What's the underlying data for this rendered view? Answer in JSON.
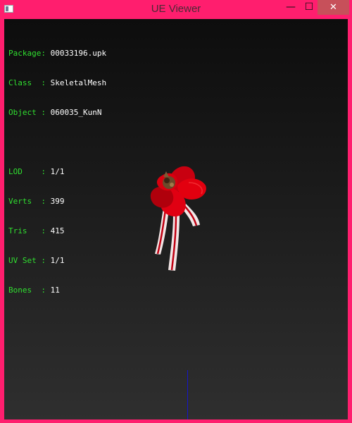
{
  "window": {
    "title": "UE Viewer"
  },
  "controls": {
    "minimize": "—",
    "maximize": "☐",
    "close": "✕"
  },
  "info": {
    "package_key": "Package:",
    "package_val": "00033196.upk",
    "class_key": "Class  :",
    "class_val": "SkeletalMesh",
    "object_key": "Object :",
    "object_val": "060035_KunN",
    "lod_key": "LOD    :",
    "lod_val": "1/1",
    "verts_key": "Verts  :",
    "verts_val": "399",
    "tris_key": "Tris   :",
    "tris_val": "415",
    "uvset_key": "UV Set :",
    "uvset_val": "1/1",
    "bones_key": "Bones  :",
    "bones_val": "11"
  },
  "colors": {
    "frame": "#ff1e6e",
    "label": "#30e030",
    "value": "#ffffff",
    "flower": "#d40010",
    "axis": "#1515cc"
  },
  "icons": {
    "app": "app-window-icon",
    "minimize": "minimize-icon",
    "maximize": "maximize-icon",
    "close": "close-icon"
  }
}
